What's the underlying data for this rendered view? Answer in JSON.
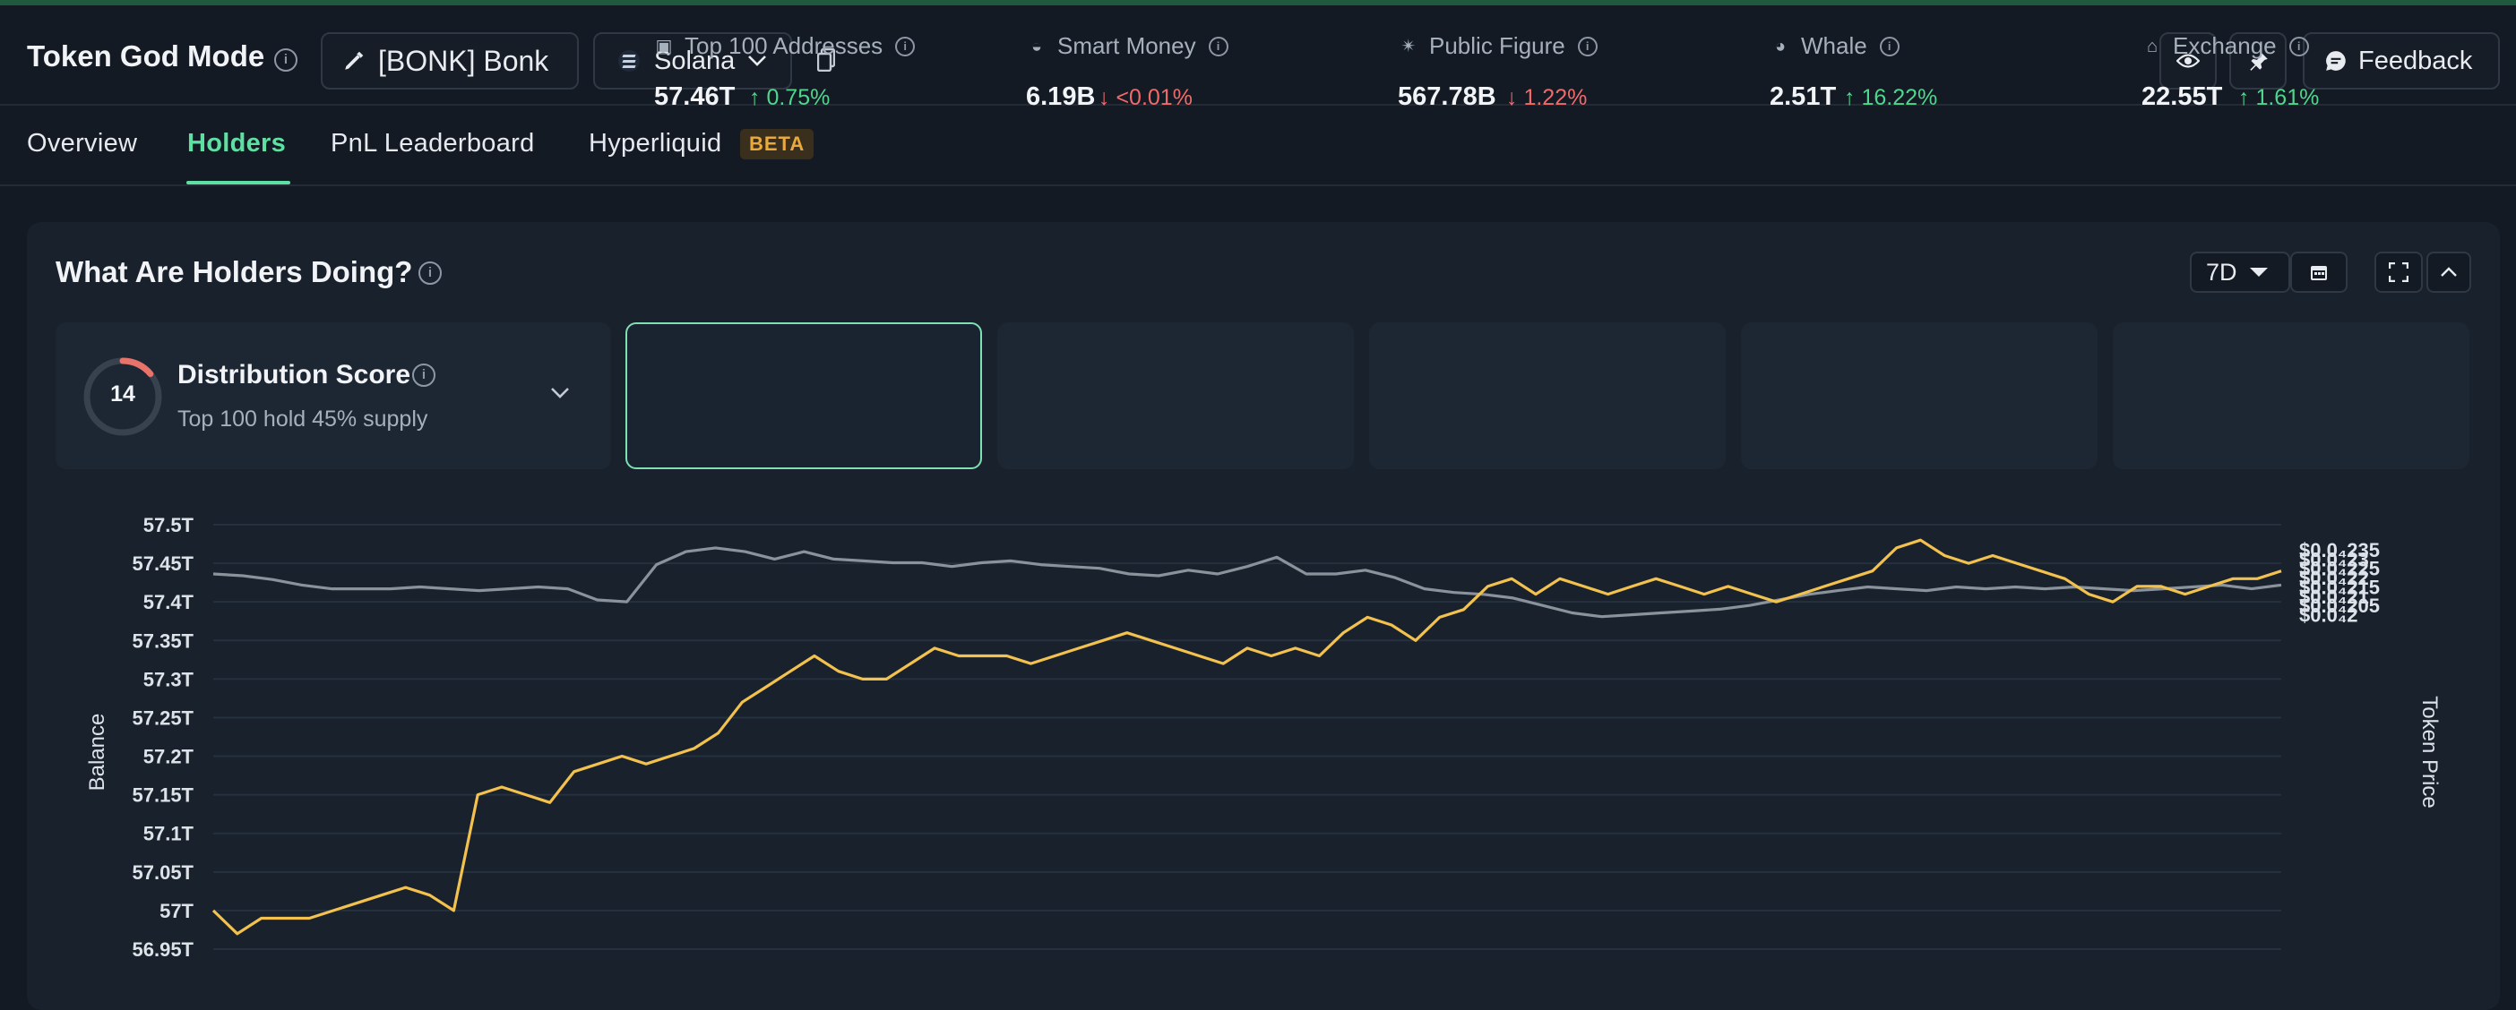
{
  "header": {
    "app_title": "Token God Mode",
    "token_label": "[BONK] Bonk",
    "chain_label": "Solana",
    "feedback_label": "Feedback"
  },
  "tabs": [
    {
      "label": "Overview",
      "active": false
    },
    {
      "label": "Holders",
      "active": true
    },
    {
      "label": "PnL Leaderboard",
      "active": false
    },
    {
      "label": "Hyperliquid",
      "active": false,
      "badge": "BETA"
    }
  ],
  "panel": {
    "title": "What Are Holders Doing?",
    "range": "7D"
  },
  "distribution": {
    "score": "14",
    "score_value": 14,
    "title": "Distribution Score",
    "subtitle": "Top 100 hold 45% supply"
  },
  "cards": [
    {
      "label": "Top 100 Addresses",
      "value": "57.46T",
      "change": "0.75%",
      "direction": "up",
      "icon": "money-icon",
      "selected": true
    },
    {
      "label": "Smart Money",
      "value": "6.19B",
      "change": "<0.01%",
      "direction": "down",
      "icon": "glasses-icon"
    },
    {
      "label": "Public Figure",
      "value": "567.78B",
      "change": "1.22%",
      "direction": "down",
      "icon": "star-person-icon"
    },
    {
      "label": "Whale",
      "value": "2.51T",
      "change": "16.22%",
      "direction": "up",
      "icon": "whale-icon"
    },
    {
      "label": "Exchange",
      "value": "22.55T",
      "change": "1.61%",
      "direction": "up",
      "icon": "bank-icon"
    }
  ],
  "colors": {
    "accent": "#5fe0a3",
    "balance_line": "#f2c14e",
    "price_line": "#8a929c",
    "up": "#4fd68d",
    "down": "#f06a6a"
  },
  "chart_data": {
    "type": "line",
    "xlabel": "",
    "ylabel": "Balance",
    "y2label": "Token Price",
    "y_ticks": [
      "57.5T",
      "57.45T",
      "57.4T",
      "57.35T",
      "57.3T",
      "57.25T",
      "57.2T",
      "57.15T",
      "57.1T",
      "57.05T",
      "57T",
      "56.95T"
    ],
    "y2_ticks": [
      "$0.0₄235",
      "$0.0₄23",
      "$0.0₄225",
      "$0.0₄22",
      "$0.0₄215",
      "$0.0₄21",
      "$0.0₄205",
      "$0.0₄2"
    ],
    "ylim": [
      56.95,
      57.5
    ],
    "y2lim": [
      2e-06,
      2.35e-05
    ],
    "grid": true,
    "series": [
      {
        "name": "Balance",
        "axis": "left",
        "values": [
          57.0,
          56.97,
          56.99,
          56.99,
          56.99,
          57.0,
          57.01,
          57.02,
          57.03,
          57.02,
          57.0,
          57.15,
          57.16,
          57.15,
          57.14,
          57.18,
          57.19,
          57.2,
          57.19,
          57.2,
          57.21,
          57.23,
          57.27,
          57.29,
          57.31,
          57.33,
          57.31,
          57.3,
          57.3,
          57.32,
          57.34,
          57.33,
          57.33,
          57.33,
          57.32,
          57.33,
          57.34,
          57.35,
          57.36,
          57.35,
          57.34,
          57.33,
          57.32,
          57.34,
          57.33,
          57.34,
          57.33,
          57.36,
          57.38,
          57.37,
          57.35,
          57.38,
          57.39,
          57.42,
          57.43,
          57.41,
          57.43,
          57.42,
          57.41,
          57.42,
          57.43,
          57.42,
          57.41,
          57.42,
          57.41,
          57.4,
          57.41,
          57.42,
          57.43,
          57.44,
          57.47,
          57.48,
          57.46,
          57.45,
          57.46,
          57.45,
          57.44,
          57.43,
          57.41,
          57.4,
          57.42,
          57.42,
          57.41,
          57.42,
          57.43,
          57.43,
          57.44
        ]
      },
      {
        "name": "Token Price",
        "axis": "right",
        "values": [
          2.22e-05,
          2.21e-05,
          2.19e-05,
          2.16e-05,
          2.14e-05,
          2.14e-05,
          2.14e-05,
          2.15e-05,
          2.14e-05,
          2.13e-05,
          2.14e-05,
          2.15e-05,
          2.14e-05,
          2.08e-05,
          2.07e-05,
          2.27e-05,
          2.34e-05,
          2.36e-05,
          2.34e-05,
          2.3e-05,
          2.34e-05,
          2.3e-05,
          2.29e-05,
          2.28e-05,
          2.28e-05,
          2.26e-05,
          2.28e-05,
          2.29e-05,
          2.27e-05,
          2.26e-05,
          2.25e-05,
          2.22e-05,
          2.21e-05,
          2.24e-05,
          2.22e-05,
          2.26e-05,
          2.31e-05,
          2.22e-05,
          2.22e-05,
          2.24e-05,
          2.2e-05,
          2.14e-05,
          2.12e-05,
          2.11e-05,
          2.09e-05,
          2.05e-05,
          2.01e-05,
          1.99e-05,
          2e-05,
          2.01e-05,
          2.02e-05,
          2.03e-05,
          2.05e-05,
          2.08e-05,
          2.11e-05,
          2.13e-05,
          2.15e-05,
          2.14e-05,
          2.13e-05,
          2.15e-05,
          2.14e-05,
          2.15e-05,
          2.14e-05,
          2.15e-05,
          2.14e-05,
          2.13e-05,
          2.14e-05,
          2.15e-05,
          2.16e-05,
          2.14e-05,
          2.16e-05
        ]
      }
    ]
  }
}
